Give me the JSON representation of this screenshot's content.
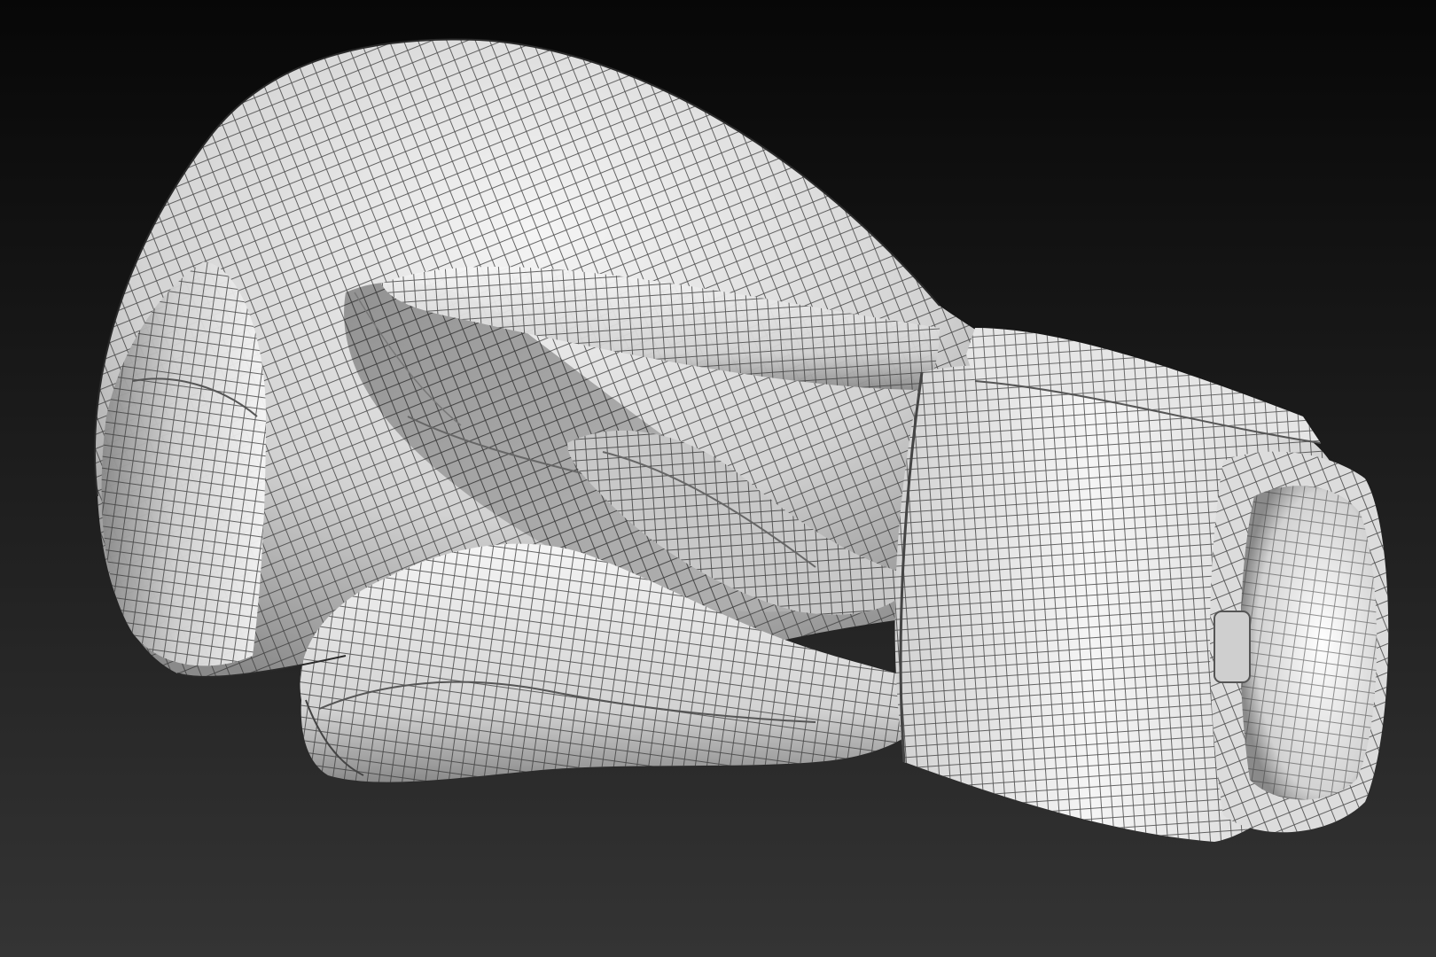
{
  "viewport": {
    "background_top": "#070707",
    "background_bottom": "#343434"
  },
  "model": {
    "material_light": "#f5f5f5",
    "material_mid": "#d2d2d2",
    "material_shadow": "#8a8a8a",
    "wireframe_color": "#3a3a3a"
  }
}
